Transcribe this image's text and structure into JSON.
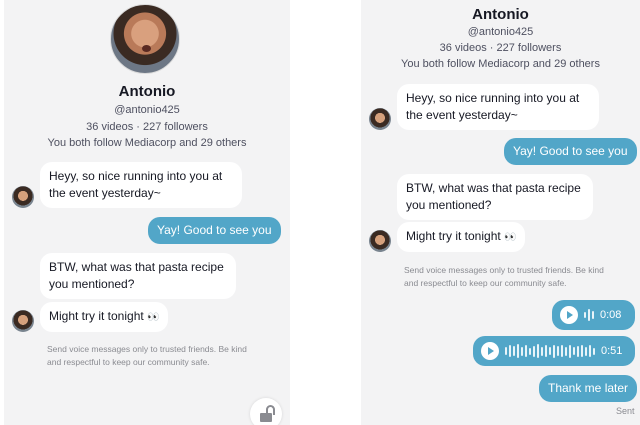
{
  "left": {
    "profile": {
      "name": "Antonio",
      "username": "@antonio425",
      "stats": "36 videos · 227 followers",
      "mutual": "You both follow Mediacorp and 29 others"
    },
    "messages": {
      "m1": "Heyy, so nice running into you at the event yesterday~",
      "m2": "Yay! Good to see you",
      "m3": "BTW, what was that pasta recipe you mentioned?",
      "m4": "Might try it tonight",
      "m4_emoji": "👀"
    },
    "notice": "Send voice messages only to trusted friends. Be kind and respectful to keep our community safe.",
    "lock_icon": "unlock-icon"
  },
  "right": {
    "profile": {
      "name": "Antonio",
      "username": "@antonio425",
      "stats": "36 videos · 227 followers",
      "mutual": "You both follow Mediacorp and 29 others"
    },
    "messages": {
      "m1": "Heyy, so nice running into you at the event yesterday~",
      "m2": "Yay! Good to see you",
      "m3": "BTW, what was that pasta recipe you mentioned?",
      "m4": "Might try it tonight",
      "m4_emoji": "👀",
      "voice1_duration": "0:08",
      "voice2_duration": "0:51",
      "m5": "Thank me later"
    },
    "notice": "Send voice messages only to trusted friends. Be kind and respectful to keep our community safe.",
    "status": "Sent"
  },
  "colors": {
    "outgoing_bubble": "#52a6c8",
    "incoming_bubble": "#ffffff",
    "background": "#f3f3f4"
  }
}
